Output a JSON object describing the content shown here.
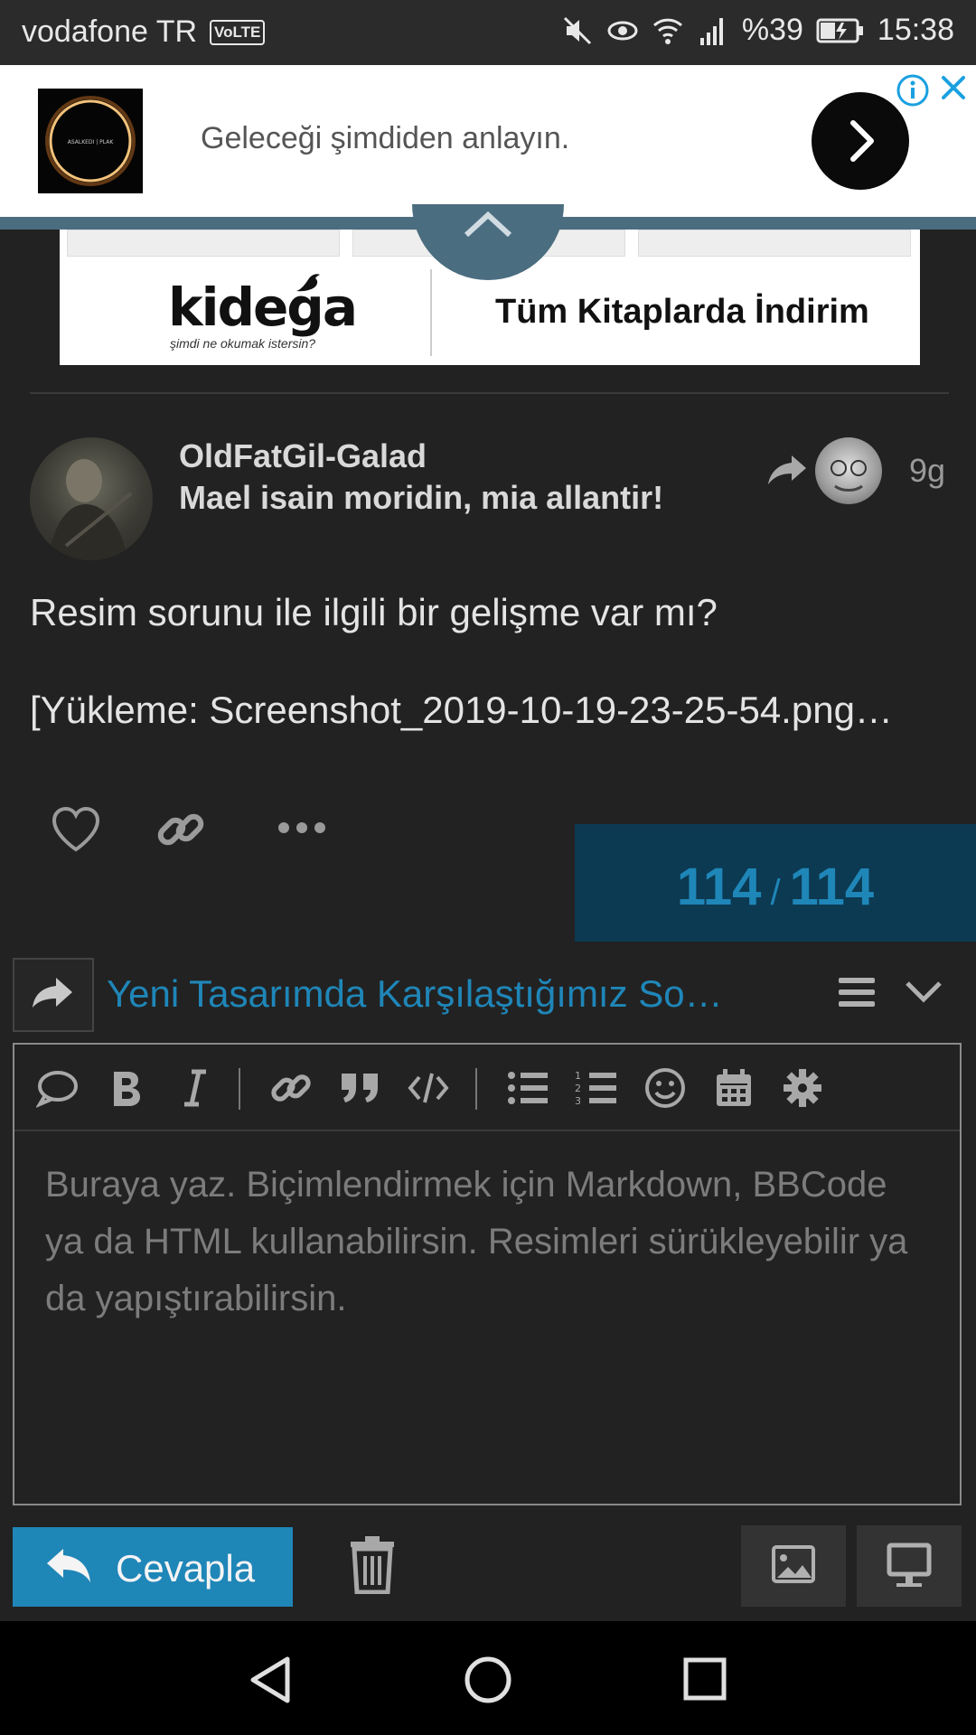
{
  "status_bar": {
    "carrier": "vodafone TR",
    "network_badge": "VoLTE",
    "battery": "%39",
    "time": "15:38",
    "icons": [
      "mute-icon",
      "eye-comfort-icon",
      "wifi-icon",
      "signal-icon",
      "battery-charging-icon"
    ]
  },
  "ad": {
    "text": "Geleceği şimdiden anlayın.",
    "thumbnail_text": "ASALKEDI | PLAK",
    "icons": [
      "ad-info-icon",
      "ad-close-icon",
      "chevron-right-icon"
    ]
  },
  "banner": {
    "logo": "kidega",
    "slogan": "şimdi ne okumak istersin?",
    "promo": "Tüm Kitaplarda İndirim"
  },
  "post": {
    "username": "OldFatGil-Galad",
    "user_title": "Mael isain moridin, mia allantir!",
    "age": "9g",
    "body_line1": "Resim sorunu ile ilgili bir gelişme var mı?",
    "body_line2": "[Yükleme: Screenshot_2019-10-19-23-25-54.png…"
  },
  "progress": {
    "current": "114",
    "separator": "/",
    "total": "114"
  },
  "composer": {
    "topic_title": "Yeni Tasarımda Karşılaştığımız So…",
    "placeholder": "Buraya yaz. Biçimlendirmek için Markdown, BBCode ya da HTML kullanabilirsin. Resimleri sürükleyebilir ya da yapıştırabilirsin.",
    "toolbar": [
      "quote-icon",
      "bold-icon",
      "italic-icon",
      "link-icon",
      "blockquote-icon",
      "code-icon",
      "bullet-list-icon",
      "numbered-list-icon",
      "emoji-icon",
      "calendar-icon",
      "gear-icon"
    ],
    "reply_label": "Cevapla"
  },
  "colors": {
    "accent": "#1f86b8",
    "progress_bg": "#0b3a52",
    "background": "#222222"
  }
}
